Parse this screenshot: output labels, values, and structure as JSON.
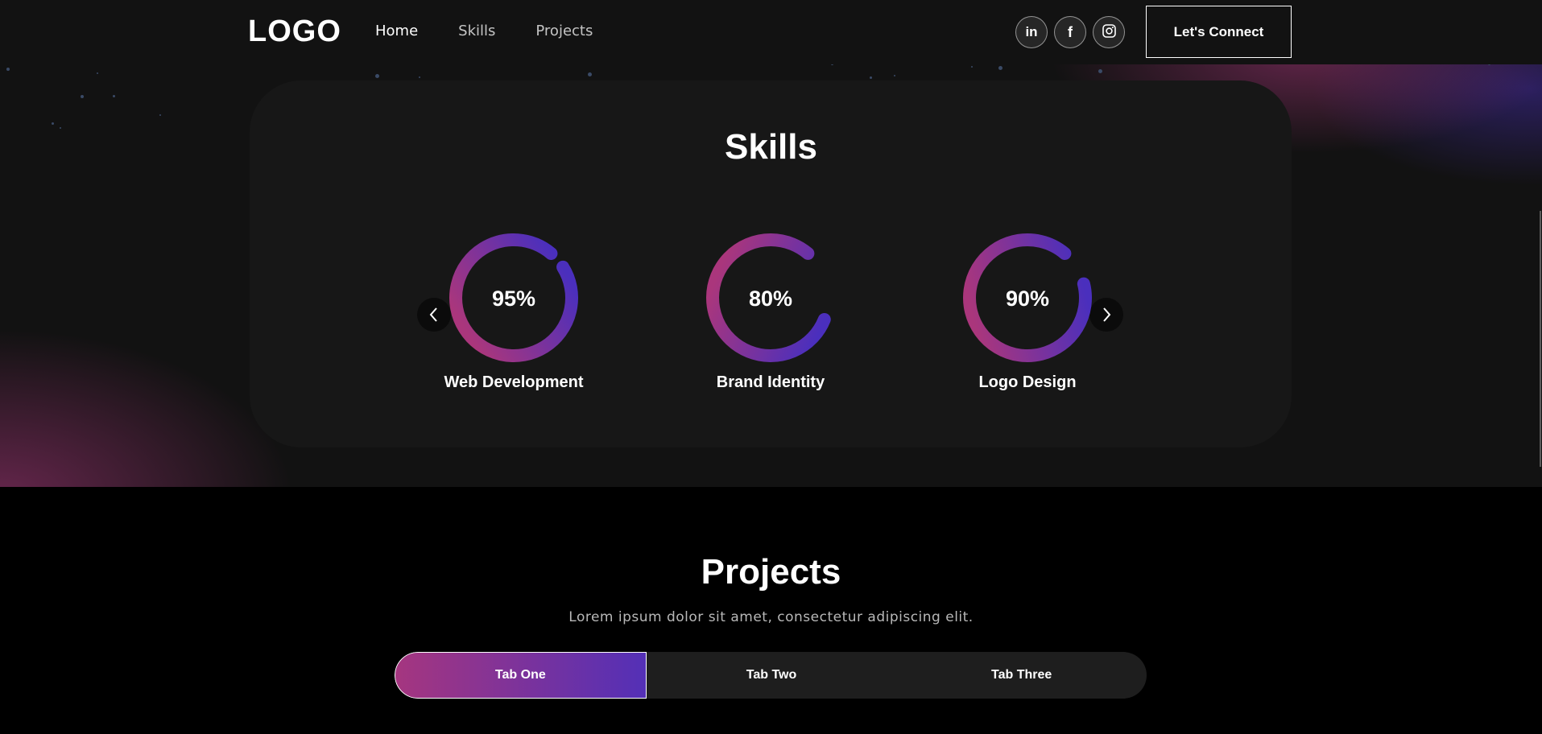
{
  "navbar": {
    "logo": "LOGO",
    "links": [
      {
        "label": "Home",
        "active": true
      },
      {
        "label": "Skills",
        "active": false
      },
      {
        "label": "Projects",
        "active": false
      }
    ],
    "socials": [
      {
        "name": "linkedin-icon",
        "glyph": "in"
      },
      {
        "name": "facebook-icon",
        "glyph": "f"
      },
      {
        "name": "instagram-icon",
        "glyph": ""
      }
    ],
    "connect_label": "Let's Connect"
  },
  "skills": {
    "title": "Skills",
    "items": [
      {
        "label": "Web Development",
        "percent_text": "95%",
        "value": 0.95
      },
      {
        "label": "Brand Identity",
        "percent_text": "80%",
        "value": 0.8
      },
      {
        "label": "Logo Design",
        "percent_text": "90%",
        "value": 0.9
      }
    ],
    "prev_icon": "chevron-left-icon",
    "next_icon": "chevron-right-icon"
  },
  "projects": {
    "title": "Projects",
    "subtitle": "Lorem ipsum dolor sit amet, consectetur adipiscing elit.",
    "tabs": [
      {
        "label": "Tab One",
        "active": true
      },
      {
        "label": "Tab Two",
        "active": false
      },
      {
        "label": "Tab Three",
        "active": false
      }
    ]
  },
  "colors": {
    "gradient_start": "#AA367C",
    "gradient_end": "#4A2FBD",
    "card_bg": "#171717"
  }
}
